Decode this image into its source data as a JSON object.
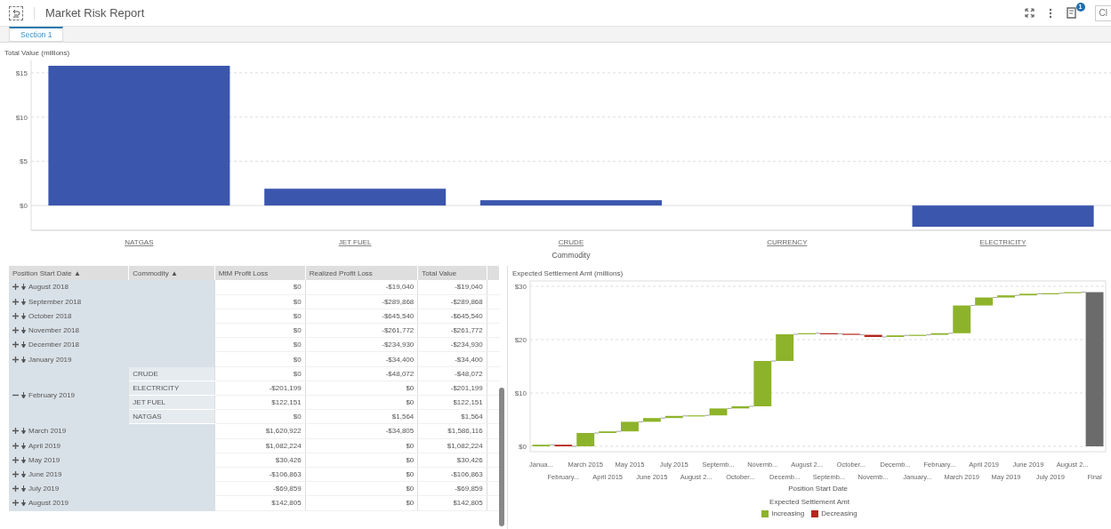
{
  "header": {
    "title": "Market Risk Report",
    "notes_badge": "1",
    "cut_button": "Cl"
  },
  "tabs": [
    {
      "label": "Section 1",
      "selected": true
    }
  ],
  "bar_chart": {
    "chart_data": {
      "type": "bar",
      "title": "Total Value (millions)",
      "xlabel": "Commodity",
      "categories": [
        "NATGAS",
        "JET FUEL",
        "CRUDE",
        "CURRENCY",
        "ELECTRICITY"
      ],
      "grid": true,
      "series": [
        {
          "color": "#3b56ad",
          "values": [
            15.8,
            1.9,
            0.6,
            0,
            -2.4
          ]
        }
      ],
      "ylim": [
        -2.8,
        16.4
      ],
      "yticks": [
        {
          "value": 0,
          "label": "$0"
        },
        {
          "value": 5,
          "label": "$5"
        },
        {
          "value": 10,
          "label": "$10"
        },
        {
          "value": 15,
          "label": "$15"
        }
      ]
    }
  },
  "table": {
    "columns": [
      {
        "label": "Position Start Date",
        "sort": "▲"
      },
      {
        "label": "Commodity",
        "sort": "▲"
      },
      {
        "label": "MtM Profit Loss"
      },
      {
        "label": "Realized Profit Loss"
      },
      {
        "label": "Total Value"
      }
    ],
    "rows": [
      {
        "date": "August 2018",
        "expanded": false,
        "values": [
          "$0",
          "-$19,040",
          "-$19,040"
        ]
      },
      {
        "date": "September 2018",
        "expanded": false,
        "values": [
          "$0",
          "-$289,868",
          "-$289,868"
        ]
      },
      {
        "date": "October 2018",
        "expanded": false,
        "values": [
          "$0",
          "-$645,540",
          "-$645,540"
        ]
      },
      {
        "date": "November 2018",
        "expanded": false,
        "values": [
          "$0",
          "-$261,772",
          "-$261,772"
        ]
      },
      {
        "date": "December 2018",
        "expanded": false,
        "values": [
          "$0",
          "-$234,930",
          "-$234,930"
        ]
      },
      {
        "date": "January 2019",
        "expanded": false,
        "values": [
          "$0",
          "-$34,400",
          "-$34,400"
        ]
      },
      {
        "date": "February 2019",
        "expanded": true,
        "children": [
          {
            "commodity": "CRUDE",
            "values": [
              "$0",
              "-$48,072",
              "-$48,072"
            ]
          },
          {
            "commodity": "ELECTRICITY",
            "values": [
              "-$201,199",
              "$0",
              "-$201,199"
            ]
          },
          {
            "commodity": "JET FUEL",
            "values": [
              "$122,151",
              "$0",
              "$122,151"
            ]
          },
          {
            "commodity": "NATGAS",
            "values": [
              "$0",
              "$1,564",
              "$1,564"
            ]
          }
        ]
      },
      {
        "date": "March 2019",
        "expanded": false,
        "values": [
          "$1,620,922",
          "-$34,805",
          "$1,586,116"
        ]
      },
      {
        "date": "April 2019",
        "expanded": false,
        "values": [
          "$1,082,224",
          "$0",
          "$1,082,224"
        ]
      },
      {
        "date": "May 2019",
        "expanded": false,
        "values": [
          "$30,426",
          "$0",
          "$30,426"
        ]
      },
      {
        "date": "June 2019",
        "expanded": false,
        "values": [
          "-$106,863",
          "$0",
          "-$106,863"
        ]
      },
      {
        "date": "July 2019",
        "expanded": false,
        "values": [
          "-$69,859",
          "$0",
          "-$69,859"
        ]
      },
      {
        "date": "August 2019",
        "expanded": false,
        "values": [
          "$142,805",
          "$0",
          "$142,805"
        ]
      }
    ]
  },
  "waterfall": {
    "chart_data": {
      "type": "candlestick",
      "title": "Expected Settlement Amt (millions)",
      "xlabel": "Position Start Date",
      "grid": true,
      "categories": [
        "Janua...",
        "February...",
        "March 2015",
        "April 2015",
        "May 2015",
        "June 2015",
        "July 2015",
        "August 2...",
        "Septemb...",
        "October...",
        "Novemb...",
        "Decemb...",
        "August 2...",
        "Septemb...",
        "October...",
        "Novemb...",
        "Decemb...",
        "January...",
        "February...",
        "March 2019",
        "April 2019",
        "May 2019",
        "June 2019",
        "July 2019",
        "August 2...",
        "Final"
      ],
      "series": [
        {
          "name": "Increasing",
          "color": "#8db32a",
          "ohlc": [
            [
              0,
              0.3,
              0,
              0.3
            ],
            null,
            [
              0,
              2.5,
              0,
              2.5
            ],
            [
              2.5,
              2.8,
              2.5,
              2.8
            ],
            [
              2.8,
              4.6,
              2.8,
              4.6
            ],
            [
              4.6,
              5.3,
              4.6,
              5.3
            ],
            [
              5.3,
              5.7,
              5.3,
              5.7
            ],
            [
              5.7,
              5.8,
              5.7,
              5.8
            ],
            [
              5.8,
              7.1,
              5.8,
              7.1
            ],
            [
              7.1,
              7.5,
              7.1,
              7.5
            ],
            [
              7.5,
              16.0,
              7.5,
              16.0
            ],
            [
              16.0,
              21.0,
              16.0,
              21.0
            ],
            [
              21.0,
              21.2,
              21.0,
              21.2
            ],
            null,
            null,
            null,
            [
              20.5,
              20.8,
              20.5,
              20.8
            ],
            [
              20.8,
              20.9,
              20.8,
              20.9
            ],
            [
              20.9,
              21.2,
              20.9,
              21.2
            ],
            [
              21.2,
              26.4,
              21.2,
              26.4
            ],
            [
              26.4,
              27.9,
              26.4,
              27.9
            ],
            [
              27.9,
              28.3,
              27.9,
              28.3
            ],
            [
              28.3,
              28.6,
              28.3,
              28.6
            ],
            [
              28.6,
              28.7,
              28.6,
              28.7
            ],
            [
              28.7,
              28.9,
              28.7,
              28.9
            ],
            null
          ]
        },
        {
          "name": "Decreasing",
          "color": "#b3261e",
          "ohlc": [
            null,
            [
              0.3,
              0.3,
              0,
              0
            ],
            null,
            null,
            null,
            null,
            null,
            null,
            null,
            null,
            null,
            null,
            null,
            [
              21.2,
              21.2,
              21.1,
              21.1
            ],
            [
              21.1,
              21.1,
              20.9,
              20.9
            ],
            [
              20.9,
              20.9,
              20.5,
              20.5
            ],
            null,
            null,
            null,
            null,
            null,
            null,
            null,
            null,
            null,
            null
          ]
        },
        {
          "color": "#6b6b6b",
          "ohlc": [
            null,
            null,
            null,
            null,
            null,
            null,
            null,
            null,
            null,
            null,
            null,
            null,
            null,
            null,
            null,
            null,
            null,
            null,
            null,
            null,
            null,
            null,
            null,
            null,
            null,
            [
              0,
              28.9,
              0,
              28.9
            ]
          ]
        }
      ],
      "ylim": [
        -1,
        31
      ],
      "yticks": [
        {
          "value": 0,
          "label": "$0"
        },
        {
          "value": 10,
          "label": "$10"
        },
        {
          "value": 20,
          "label": "$20"
        },
        {
          "value": 30,
          "label": "$30"
        }
      ]
    },
    "legend": {
      "title": "Expected Settlement Amt"
    }
  }
}
